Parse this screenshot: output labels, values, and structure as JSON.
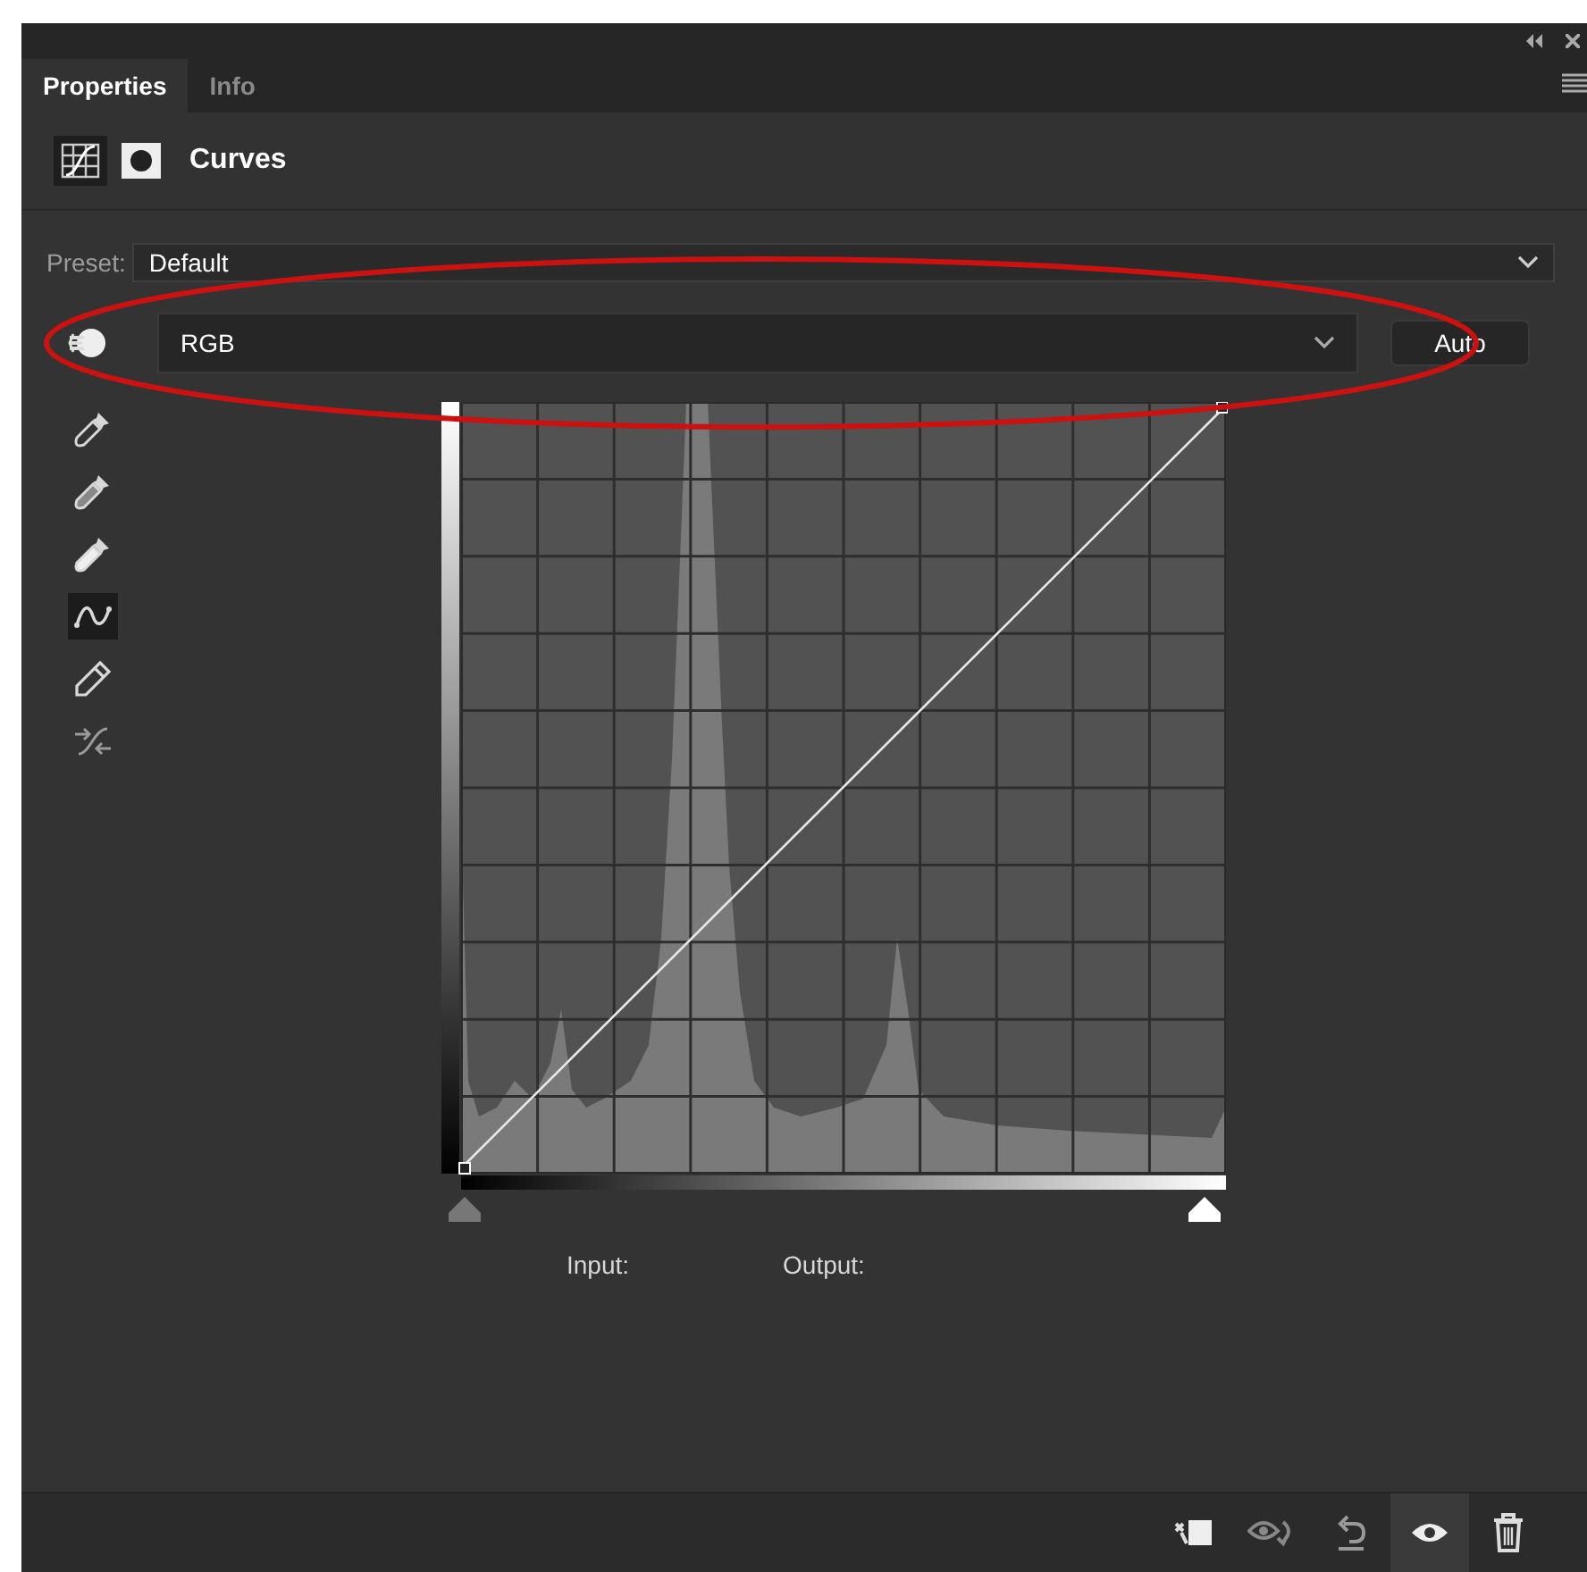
{
  "tabs": [
    {
      "label": "Properties",
      "selected": true
    },
    {
      "label": "Info",
      "selected": false
    }
  ],
  "adjustment": {
    "title": "Curves"
  },
  "preset": {
    "label": "Preset:",
    "value": "Default"
  },
  "channel": {
    "value": "RGB",
    "auto_button": "Auto"
  },
  "tools": [
    {
      "kind": "black-eyedropper",
      "selected": false
    },
    {
      "kind": "gray-eyedropper",
      "selected": false
    },
    {
      "kind": "white-eyedropper",
      "selected": false
    },
    {
      "kind": "curve-points",
      "selected": true
    },
    {
      "kind": "pencil",
      "selected": false
    },
    {
      "kind": "smooth",
      "selected": false
    }
  ],
  "readouts": {
    "input_label": "Input:",
    "output_label": "Output:"
  },
  "footer_buttons": [
    {
      "kind": "clip",
      "selected": false
    },
    {
      "kind": "view-previous",
      "selected": false
    },
    {
      "kind": "reset",
      "selected": false
    },
    {
      "kind": "visibility",
      "selected": true
    },
    {
      "kind": "delete",
      "selected": false
    }
  ]
}
